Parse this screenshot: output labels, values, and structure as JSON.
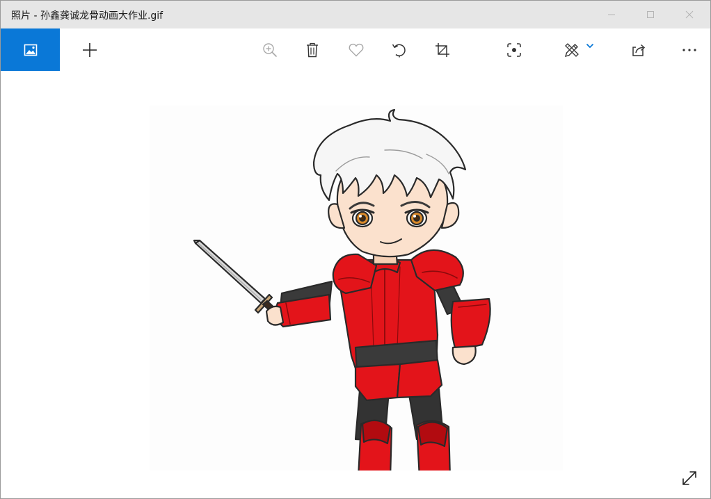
{
  "window": {
    "title": "照片 - 孙鑫龚诚龙骨动画大作业.gif"
  },
  "icons": {
    "collection": "image-icon",
    "add": "plus-icon",
    "zoom": "zoom-in-icon",
    "delete": "trash-icon",
    "favorite": "heart-icon",
    "rotate": "rotate-icon",
    "crop": "crop-icon",
    "enhance": "enhance-focus-icon",
    "edit": "edit-create-icon",
    "share": "share-icon",
    "more": "more-icon",
    "fullscreen": "expand-icon"
  },
  "colors": {
    "accent": "#0a78d7",
    "titlebar": "#e6e6e6",
    "icon": "#333333",
    "icon_disabled": "#a8a8a8",
    "armor": "#e3141a",
    "armor_dark": "#8c0a0c"
  }
}
